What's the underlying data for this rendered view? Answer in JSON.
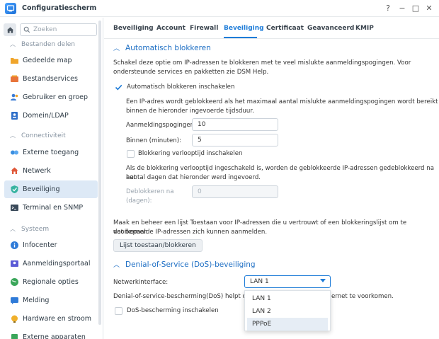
{
  "window": {
    "title": "Configuratiescherm"
  },
  "window_controls": {
    "help": "?",
    "minimize": "−",
    "maximize": "□",
    "close": "✕"
  },
  "sidebar": {
    "search_placeholder": "Zoeken",
    "sections": [
      {
        "label": "Bestanden delen"
      },
      {
        "label": "Connectiviteit"
      },
      {
        "label": "Systeem"
      }
    ],
    "items": [
      {
        "label": "Gedeelde map",
        "icon": "folder-share-icon",
        "color": "#f0a52b"
      },
      {
        "label": "Bestandservices",
        "icon": "file-services-icon",
        "color": "#e8743b"
      },
      {
        "label": "Gebruiker en groep",
        "icon": "user-group-icon",
        "color": "#3a7bd5"
      },
      {
        "label": "Domein/LDAP",
        "icon": "domain-ldap-icon",
        "color": "#2f6fc9"
      },
      {
        "label": "Externe toegang",
        "icon": "external-access-icon",
        "color": "#3b8fe0"
      },
      {
        "label": "Netwerk",
        "icon": "network-icon",
        "color": "#e05a3b"
      },
      {
        "label": "Beveiliging",
        "icon": "shield-icon",
        "color": "#36b3a0"
      },
      {
        "label": "Terminal en SNMP",
        "icon": "terminal-icon",
        "color": "#3a4a5a"
      },
      {
        "label": "Infocenter",
        "icon": "info-icon",
        "color": "#2f7bd8"
      },
      {
        "label": "Aanmeldingsportaal",
        "icon": "login-portal-icon",
        "color": "#5b5bd6"
      },
      {
        "label": "Regionale opties",
        "icon": "regional-options-icon",
        "color": "#3aa65a"
      },
      {
        "label": "Melding",
        "icon": "notification-icon",
        "color": "#2f7bd8"
      },
      {
        "label": "Hardware en stroom",
        "icon": "hardware-power-icon",
        "color": "#f0b02b"
      },
      {
        "label": "Externe apparaten",
        "icon": "external-devices-icon",
        "color": "#3aa65a"
      }
    ],
    "active_item": "Beveiliging"
  },
  "tabs": [
    {
      "label": "Beveiliging"
    },
    {
      "label": "Account"
    },
    {
      "label": "Firewall"
    },
    {
      "label": "Beveiliging"
    },
    {
      "label": "Certificaat"
    },
    {
      "label": "Geavanceerd"
    },
    {
      "label": "KMIP"
    }
  ],
  "active_tab_index": 3,
  "autoblock": {
    "title": "Automatisch blokkeren",
    "desc_line1": "Schakel deze optie om IP-adressen te blokkeren met te veel mislukte aanmeldingspogingen. Voor",
    "desc_line2": "ondersteunde services en pakketten zie DSM Help.",
    "enable_label": "Automatisch blokkeren inschakelen",
    "enable_checked": true,
    "info_line1": "Een IP-adres wordt geblokkeerd als het maximaal aantal mislukte aanmeldingspogingen wordt bereikt",
    "info_line2": "binnen de hieronder ingevoerde tijdsduur.",
    "attempts_label": "Aanmeldingspogingen:",
    "attempts_value": "10",
    "within_label": "Binnen (minuten):",
    "within_value": "5",
    "expire_label": "Blokkering verlooptijd inschakelen",
    "expire_checked": false,
    "expire_info_line1": "Als de blokkering verlooptijd ingeschakeld is, worden de geblokkeerde IP-adressen gedeblokkeerd na het",
    "expire_info_line2": "aantal dagen dat hieronder werd ingevoerd.",
    "unblock_label_line1": "Deblokkeren na",
    "unblock_label_line2": "(dagen):",
    "unblock_value": "0",
    "allow_line1": "Maak en beheer een lijst Toestaan voor IP-adressen die u vertrouwt of een blokkeringslijst om te voorkomen",
    "allow_line2": "dat bepaalde IP-adressen zich kunnen aanmelden.",
    "allow_button": "Lijst toestaan/blokkeren"
  },
  "dos": {
    "title": "Denial-of-Service (DoS)-beveiliging",
    "interface_label": "Netwerkinterface:",
    "interface_value": "LAN 1",
    "desc_left": "Denial-of-service-bescherming(DoS) helpt om",
    "desc_right": "ernet te voorkomen.",
    "enable_label": "DoS-bescherming inschakelen",
    "enable_checked": false,
    "options": [
      "LAN 1",
      "LAN 2",
      "PPPoE"
    ],
    "highlighted_option": "PPPoE"
  },
  "colors": {
    "accent": "#1e7cd8",
    "active_bg": "#dde9f6",
    "section_head": "#1e6fc4"
  }
}
